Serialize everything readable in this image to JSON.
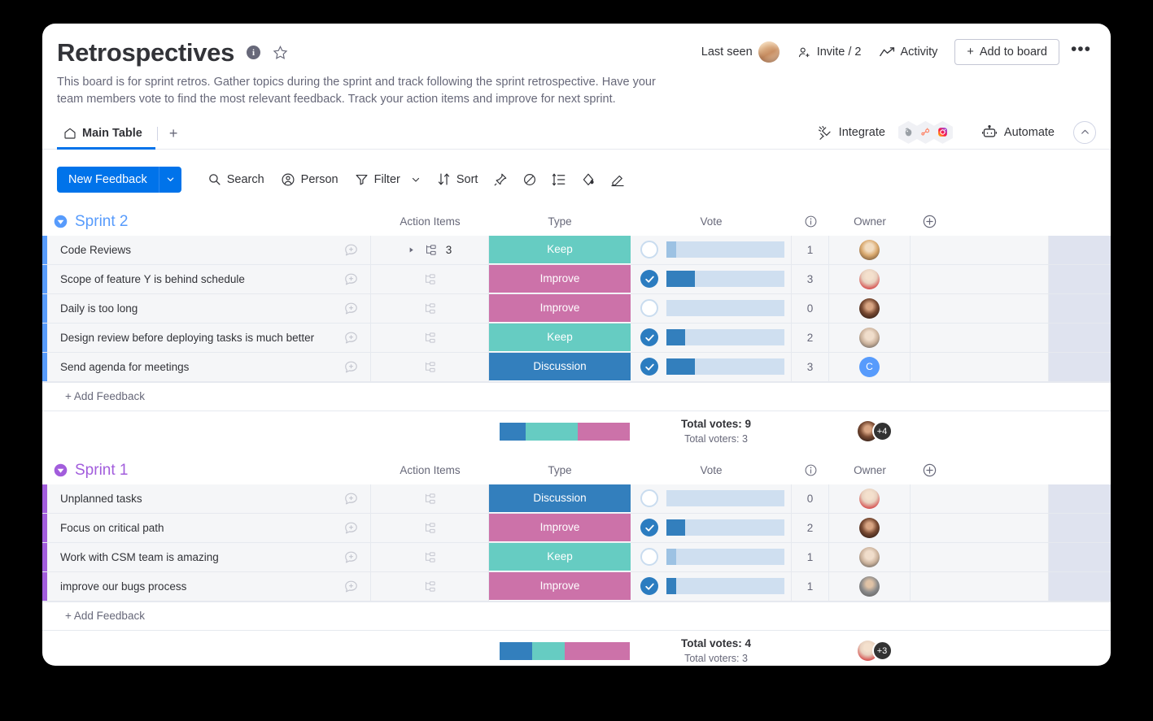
{
  "board": {
    "title": "Retrospectives",
    "info_icon": "info-icon",
    "star_icon": "star-icon",
    "description": "This board is for sprint retros. Gather topics during the sprint and track following the sprint retrospective. Have your team members vote to find the most relevant feedback. Track your action items and improve for next sprint."
  },
  "header_actions": {
    "last_seen_label": "Last seen",
    "invite_label": "Invite / 2",
    "activity_label": "Activity",
    "add_to_board_label": "Add to board",
    "more_label": "•••"
  },
  "tabs": {
    "items": [
      {
        "label": "Main Table",
        "icon": "home-icon"
      }
    ],
    "add_label": "+",
    "integrate_label": "Integrate",
    "automate_label": "Automate",
    "apps": [
      "mailchimp-icon",
      "hubspot-icon",
      "instagram-icon"
    ]
  },
  "toolbar": {
    "new_feedback_label": "New Feedback",
    "caret_label": "⌄",
    "search_label": "Search",
    "person_label": "Person",
    "filter_label": "Filter",
    "sort_label": "Sort",
    "icons": [
      "pin-icon",
      "hide-icon",
      "row-height-icon",
      "color-icon",
      "edit-icon"
    ]
  },
  "columns": {
    "name": "",
    "action_items": "Action Items",
    "type": "Type",
    "vote": "Vote",
    "vote_info": "info-icon",
    "owner": "Owner",
    "add_column": "add-column-icon"
  },
  "colors": {
    "accent": "#0073ea",
    "keep": "#66ccc2",
    "improve": "#cc72a9",
    "discussion": "#337fbd",
    "sprint2_group": "#579bfc",
    "sprint1_group": "#a25ddc",
    "vote_track": "#cfdff0",
    "vote_fill_on": "#337fbd",
    "vote_fill_off": "#9dc2e3"
  },
  "groups": [
    {
      "title": "Sprint 2",
      "color": "#579bfc",
      "add_label": "+ Add Feedback",
      "rows": [
        {
          "name": "Code Reviews",
          "action_items": "3",
          "has_subitems": true,
          "type": "Keep",
          "type_color": "#66ccc2",
          "voted": false,
          "vote_count": "1",
          "vote_pct": 8,
          "owner_kind": "photo",
          "owner_avatar": "avatar-blonde"
        },
        {
          "name": "Scope of feature Y is behind schedule",
          "action_items": "",
          "has_subitems": false,
          "type": "Improve",
          "type_color": "#cc72a9",
          "voted": true,
          "vote_count": "3",
          "vote_pct": 24,
          "owner_kind": "photo",
          "owner_avatar": "avatar-red-dress"
        },
        {
          "name": "Daily is too long",
          "action_items": "",
          "has_subitems": false,
          "type": "Improve",
          "type_color": "#cc72a9",
          "voted": false,
          "vote_count": "0",
          "vote_pct": 0,
          "owner_kind": "photo",
          "owner_avatar": "avatar-dark-hair"
        },
        {
          "name": "Design review before deploying tasks is much better",
          "action_items": "",
          "has_subitems": false,
          "type": "Keep",
          "type_color": "#66ccc2",
          "voted": true,
          "vote_count": "2",
          "vote_pct": 16,
          "owner_kind": "photo",
          "owner_avatar": "avatar-glasses"
        },
        {
          "name": "Send agenda for meetings",
          "action_items": "",
          "has_subitems": false,
          "type": "Discussion",
          "type_color": "#337fbd",
          "voted": true,
          "vote_count": "3",
          "vote_pct": 24,
          "owner_kind": "initial",
          "owner_initial": "C",
          "owner_bg": "#579bfc"
        }
      ],
      "summary": {
        "type_segments": [
          {
            "label": "Discussion",
            "color": "#337fbd",
            "pct": 20
          },
          {
            "label": "Keep",
            "color": "#66ccc2",
            "pct": 40
          },
          {
            "label": "Improve",
            "color": "#cc72a9",
            "pct": 40
          }
        ],
        "total_votes": "Total votes: 9",
        "total_voters": "Total voters: 3",
        "avatar": "avatar-dark-hair",
        "extra_count": "+4"
      }
    },
    {
      "title": "Sprint 1",
      "color": "#a25ddc",
      "add_label": "+ Add Feedback",
      "rows": [
        {
          "name": "Unplanned tasks",
          "action_items": "",
          "has_subitems": false,
          "type": "Discussion",
          "type_color": "#337fbd",
          "voted": false,
          "vote_count": "0",
          "vote_pct": 0,
          "owner_kind": "photo",
          "owner_avatar": "avatar-red-dress"
        },
        {
          "name": "Focus on critical path",
          "action_items": "",
          "has_subitems": false,
          "type": "Improve",
          "type_color": "#cc72a9",
          "voted": true,
          "vote_count": "2",
          "vote_pct": 16,
          "owner_kind": "photo",
          "owner_avatar": "avatar-dark-hair"
        },
        {
          "name": "Work with CSM team is amazing",
          "action_items": "",
          "has_subitems": false,
          "type": "Keep",
          "type_color": "#66ccc2",
          "voted": false,
          "vote_count": "1",
          "vote_pct": 8,
          "owner_kind": "photo",
          "owner_avatar": "avatar-glasses"
        },
        {
          "name": "improve our bugs process",
          "action_items": "",
          "has_subitems": false,
          "type": "Improve",
          "type_color": "#cc72a9",
          "voted": true,
          "vote_count": "1",
          "vote_pct": 8,
          "owner_kind": "photo",
          "owner_avatar": "avatar-man-gray"
        }
      ],
      "summary": {
        "type_segments": [
          {
            "label": "Discussion",
            "color": "#337fbd",
            "pct": 25
          },
          {
            "label": "Keep",
            "color": "#66ccc2",
            "pct": 25
          },
          {
            "label": "Improve",
            "color": "#cc72a9",
            "pct": 50
          }
        ],
        "total_votes": "Total votes: 4",
        "total_voters": "Total voters: 3",
        "avatar": "avatar-red-dress",
        "extra_count": "+3"
      }
    }
  ]
}
